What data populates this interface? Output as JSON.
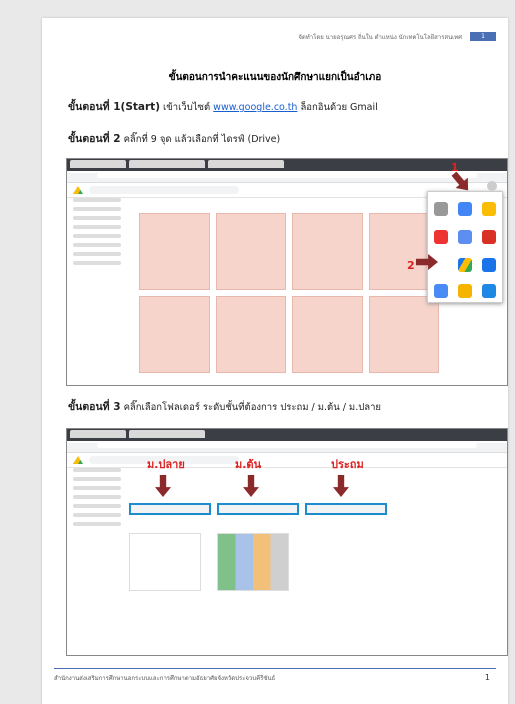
{
  "header": {
    "text": "จัดทำโดย นายอรุณศร ถิ่นใน ตำแหน่ง นักเทคโนโลยีสารสนเทศ",
    "tag": "1"
  },
  "title": "ขั้นตอนการนำคะแนนของนักศึกษาแยกเป็นอำเภอ",
  "step1": {
    "label": "ขั้นตอนที่ 1(Start)",
    "text": "เข้าเว็บไซต์",
    "link": "www.google.co.th",
    "tail": "ล็อกอินด้วย Gmail"
  },
  "step2": {
    "label": "ขั้นตอนที่ 2",
    "text": "คลิ๊กที่ 9 จุด แล้วเลือกที่ ไดรฟ์ (Drive)",
    "mark1": "1",
    "mark2": "2"
  },
  "step3": {
    "label": "ขั้นตอนที่ 3",
    "text": "คลิ๊กเลือกโฟลเดอร์ ระดับชั้นที่ต้องการ ประถม / ม.ต้น / ม.ปลาย",
    "labels": [
      "ม.ปลาย",
      "ม.ต้น",
      "ประถม"
    ]
  },
  "footer": {
    "text": "สำนักงานส่งเสริมการศึกษานอกระบบและการศึกษาตามอัธยาศัยจังหวัดประจวบคีรีขันธ์",
    "page": "1"
  }
}
